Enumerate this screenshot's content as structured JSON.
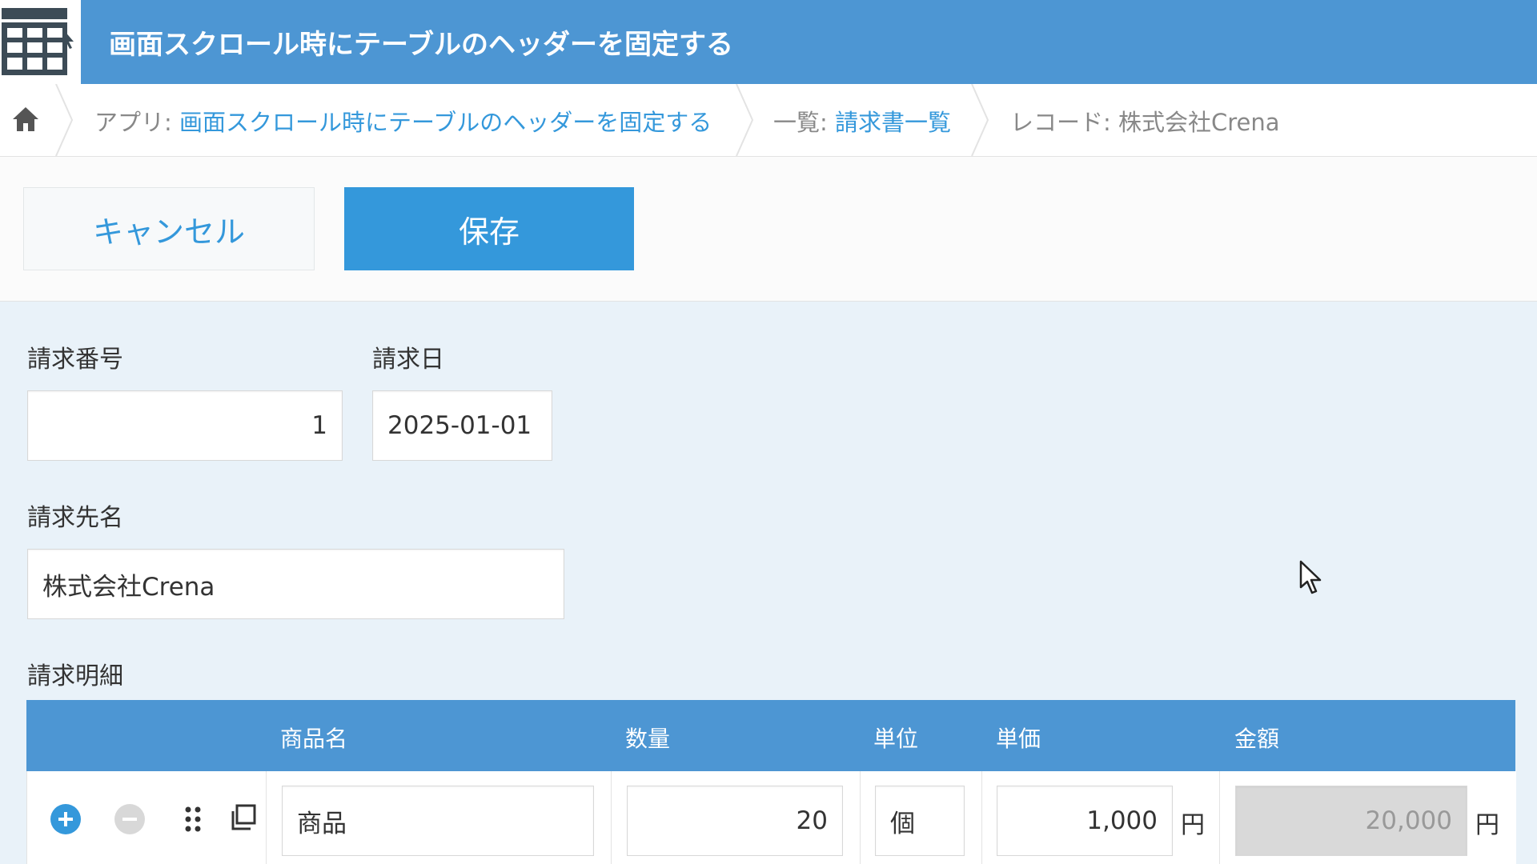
{
  "header": {
    "title": "画面スクロール時にテーブルのヘッダーを固定する",
    "app_icon": "table-grid-icon",
    "color": "#4d96d3"
  },
  "breadcrumb": {
    "home_icon": "home-icon",
    "app_prefix": "アプリ: ",
    "app_name": "画面スクロール時にテーブルのヘッダーを固定する",
    "list_prefix": "一覧: ",
    "list_name": "請求書一覧",
    "record_prefix": "レコード: ",
    "record_name": "株式会社Crena"
  },
  "toolbar": {
    "cancel_label": "キャンセル",
    "save_label": "保存"
  },
  "form": {
    "invoice_number_label": "請求番号",
    "invoice_number_value": "1",
    "invoice_date_label": "請求日",
    "invoice_date_value": "2025-01-01",
    "customer_label": "請求先名",
    "customer_value": "株式会社Crena",
    "details_label": "請求明細"
  },
  "table": {
    "headers": [
      "商品名",
      "数量",
      "単位",
      "単価",
      "金額"
    ],
    "rows": [
      {
        "product": "商品",
        "quantity": "20",
        "unit": "個",
        "unit_price": "1,000",
        "unit_price_suffix": "円",
        "amount": "20,000",
        "amount_suffix": "円"
      }
    ],
    "row_icons": [
      "add-row-icon",
      "remove-row-icon",
      "drag-handle-icon",
      "copy-row-icon"
    ]
  },
  "colors": {
    "accent": "#3498db",
    "header_bg": "#4d96d3",
    "form_bg": "#e9f2f9"
  }
}
